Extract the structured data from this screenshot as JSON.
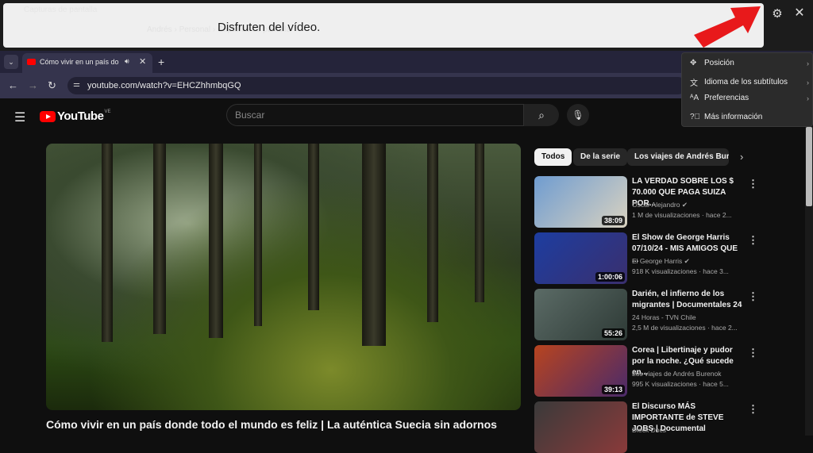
{
  "caption_window": {
    "ghost_title": "Capturas de pantalla",
    "ghost_path": "Andrés › Personal › Capturas de pantalla",
    "caption": "Disfruten del vídeo.",
    "settings_icon": "gear-icon",
    "close_icon": "close-icon"
  },
  "settings_menu": {
    "items": [
      {
        "label": "Posición",
        "icon": "move-icon"
      },
      {
        "label": "Idioma de los subtítulos",
        "icon": "language-icon"
      },
      {
        "label": "Preferencias",
        "icon": "text-size-icon"
      },
      {
        "label": "Más información",
        "icon": "help-icon"
      }
    ]
  },
  "browser": {
    "tab_title": "Cómo vivir en un país donde todo el mundo es feliz",
    "url": "youtube.com/watch?v=EHCZhhmbqGQ",
    "new_tab": "+"
  },
  "youtube": {
    "logo": "YouTube",
    "country": "VE",
    "search_placeholder": "Buscar",
    "video_title": "Cómo vivir en un país donde todo el mundo es feliz | La auténtica Suecia sin adornos",
    "chips": [
      "Todos",
      "De la serie",
      "Los viajes de Andrés Burenok"
    ],
    "recommendations": [
      {
        "title": "LA VERDAD SOBRE LOS $ 70.000 QUE PAGA SUIZA POR...",
        "channel": "Oscar Alejandro ✔",
        "meta": "1 M de visualizaciones · hace 2...",
        "duration": "38:09",
        "colors": [
          "#6f9cd0",
          "#d9d2c0"
        ]
      },
      {
        "title": "El Show de George Harris 07/10/24 - MIS AMIGOS QUE ...",
        "channel": "El George Harris ✔",
        "meta": "918 K visualizaciones · hace 3...",
        "duration": "1:00:06",
        "colors": [
          "#1d3da0",
          "#3a2f6e"
        ]
      },
      {
        "title": "Darién, el infierno de los migrantes | Documentales 24",
        "channel": "24 Horas - TVN Chile",
        "meta": "2,5 M de visualizaciones · hace 2...",
        "duration": "55:26",
        "colors": [
          "#5b6b66",
          "#2e3a36"
        ]
      },
      {
        "title": "Corea | Libertinaje y pudor por la noche. ¿Qué sucede en...",
        "channel": "Los viajes de Andrés Burenok",
        "meta": "995 K visualizaciones · hace 5...",
        "duration": "39:13",
        "colors": [
          "#b8441f",
          "#4a2a6a"
        ]
      },
      {
        "title": "El Discurso MÁS IMPORTANTE de STEVE JOBS | Documental",
        "channel": "Dieck Docs",
        "meta": "",
        "duration": "",
        "colors": [
          "#3a3a3a",
          "#8a3a3a"
        ]
      }
    ]
  }
}
